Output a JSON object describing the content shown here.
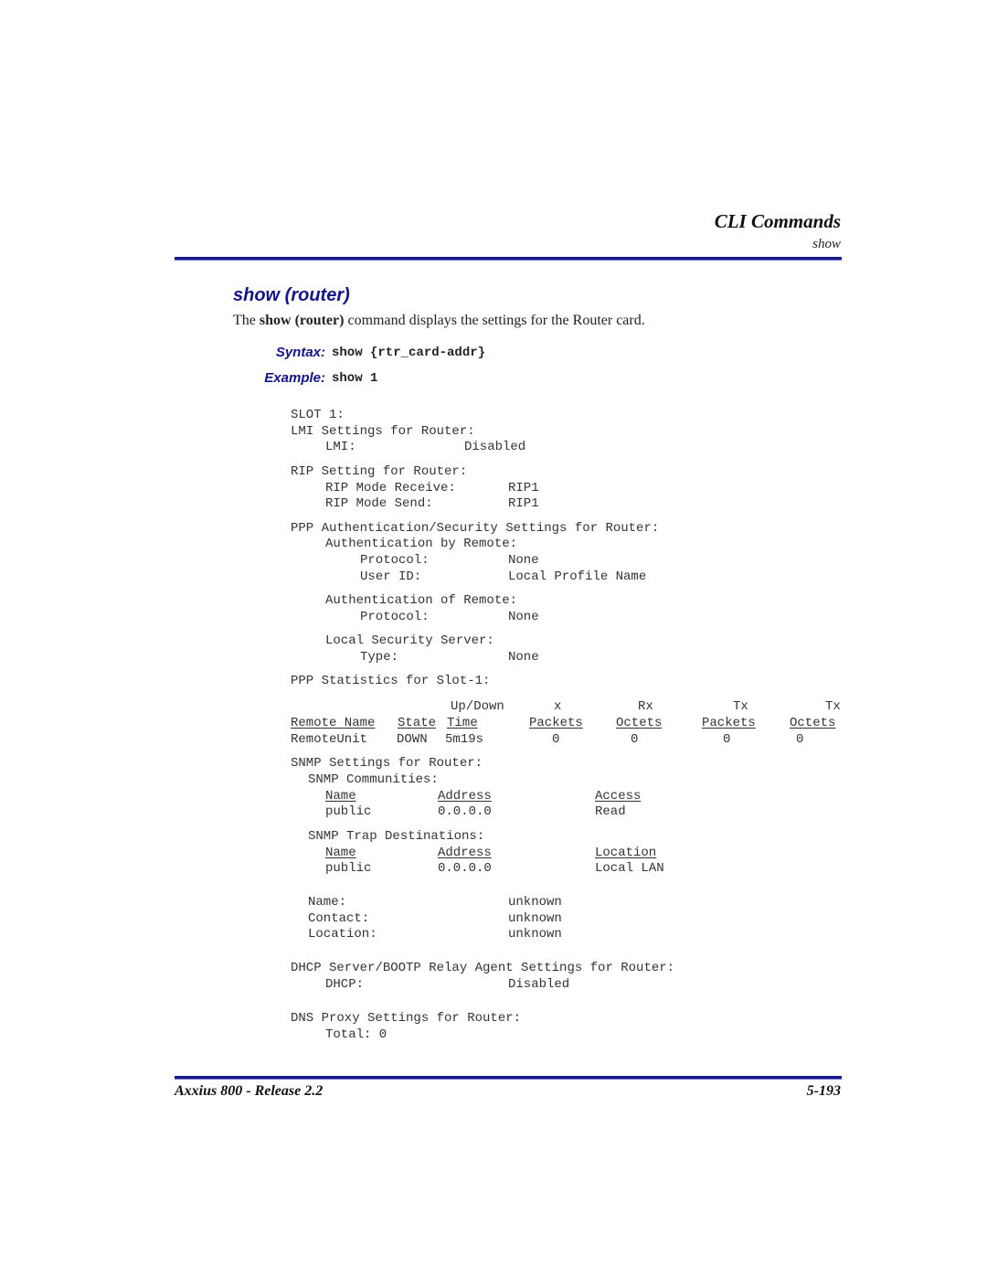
{
  "header": {
    "title": "CLI Commands",
    "subtitle": "show"
  },
  "section": {
    "title": "show (router)",
    "description": {
      "prefix": "The ",
      "bold1": "show",
      "space": " ",
      "bold2": "(router)",
      "suffix": " command displays the settings for the Router card."
    },
    "syntax_label": "Syntax:",
    "syntax_value": "show {rtr_card-addr}",
    "example_label": "Example:",
    "example_value": "show 1"
  },
  "output": {
    "slot": "SLOT 1:",
    "lmi": {
      "heading": "LMI Settings for Router:",
      "rows": [
        {
          "label": "LMI:",
          "value": "Disabled"
        }
      ]
    },
    "rip": {
      "heading": "RIP Setting for Router:",
      "rows": [
        {
          "label": "RIP Mode Receive:",
          "value": "RIP1"
        },
        {
          "label": "RIP Mode Send:",
          "value": "RIP1"
        }
      ]
    },
    "ppp_auth": {
      "heading": "PPP Authentication/Security Settings for Router:",
      "by_remote": {
        "heading": "Authentication by Remote:",
        "rows": [
          {
            "label": "Protocol:",
            "value": "None"
          },
          {
            "label": "User ID:",
            "value": "Local Profile Name"
          }
        ]
      },
      "of_remote": {
        "heading": "Authentication of Remote:",
        "rows": [
          {
            "label": "Protocol:",
            "value": "None"
          }
        ]
      },
      "local_server": {
        "heading": "Local Security Server:",
        "rows": [
          {
            "label": "Type:",
            "value": "None"
          }
        ]
      }
    },
    "ppp_stats": {
      "heading": "PPP Statistics for Slot-1:",
      "header_top": [
        "Up/Down",
        "x",
        "Rx",
        "Tx",
        "Tx"
      ],
      "columns": [
        "Remote Name",
        "State",
        "Time",
        "Packets",
        "Octets",
        "Packets",
        "Octets"
      ],
      "rows": [
        [
          "RemoteUnit",
          "DOWN",
          "5m19s",
          "0",
          "0",
          "0",
          "0"
        ]
      ]
    },
    "snmp": {
      "heading": "SNMP Settings for Router:",
      "communities": {
        "heading": "SNMP Communities:",
        "columns": [
          "Name",
          "Address",
          "Access"
        ],
        "rows": [
          [
            "public",
            "0.0.0.0",
            "Read"
          ]
        ]
      },
      "traps": {
        "heading": "SNMP Trap Destinations:",
        "columns": [
          "Name",
          "Address",
          "Location"
        ],
        "rows": [
          [
            "public",
            "0.0.0.0",
            "Local LAN"
          ]
        ]
      },
      "system": [
        {
          "label": "Name:",
          "value": "unknown"
        },
        {
          "label": "Contact:",
          "value": "unknown"
        },
        {
          "label": "Location:",
          "value": "unknown"
        }
      ]
    },
    "dhcp": {
      "heading": "DHCP Server/BOOTP Relay Agent Settings for Router:",
      "rows": [
        {
          "label": "DHCP:",
          "value": "Disabled"
        }
      ]
    },
    "dns": {
      "heading": "DNS Proxy Settings for Router:",
      "total": "Total: 0"
    }
  },
  "footer": {
    "left": "Axxius 800 - Release 2.2",
    "right": "5-193"
  },
  "colors": {
    "accent": "#14148a",
    "rule": "#1a1a8c"
  }
}
